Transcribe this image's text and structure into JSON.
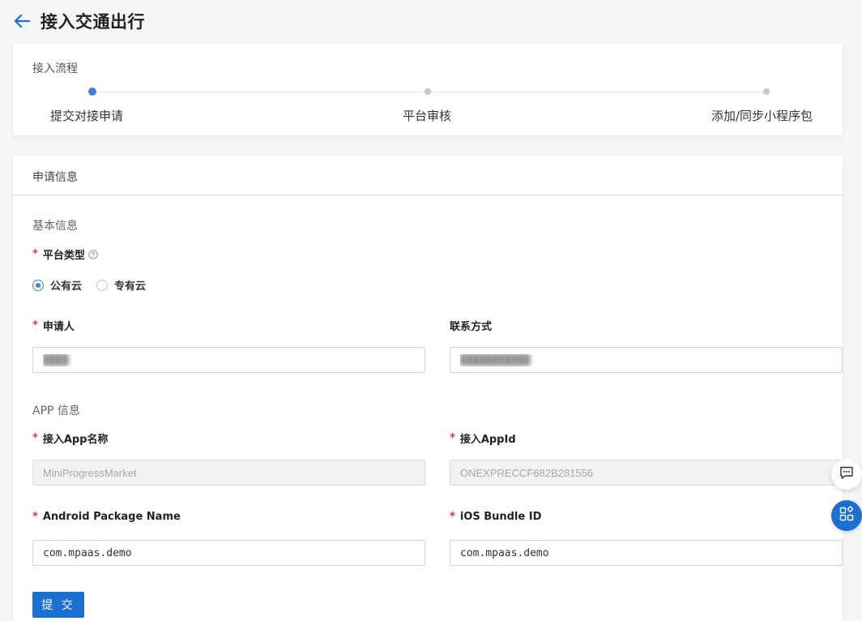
{
  "header": {
    "title": "接入交通出行"
  },
  "flow": {
    "title": "接入流程",
    "steps": [
      {
        "label": "提交对接申请",
        "active": true
      },
      {
        "label": "平台审核",
        "active": false
      },
      {
        "label": "添加/同步小程序包",
        "active": false
      }
    ]
  },
  "form": {
    "title": "申请信息",
    "basic_section": "基本信息",
    "platform_type": {
      "label": "平台类型",
      "options": [
        {
          "label": "公有云",
          "checked": true
        },
        {
          "label": "专有云",
          "checked": false
        }
      ]
    },
    "applicant": {
      "label": "申请人",
      "value": "████"
    },
    "contact": {
      "label": "联系方式",
      "value": "███████████"
    },
    "app_section": "APP 信息",
    "app_name": {
      "label": "接入App名称",
      "value": "MiniProgressMarket"
    },
    "app_id": {
      "label": "接入AppId",
      "value": "ONEXPRECCF682B281556"
    },
    "android_package": {
      "label": "Android Package Name",
      "value": "com.mpaas.demo"
    },
    "ios_bundle": {
      "label": "iOS Bundle ID",
      "value": "com.mpaas.demo"
    },
    "required_mark": "*",
    "submit_label": "提 交"
  },
  "colors": {
    "primary": "#1a6fd1",
    "active_step": "#3e82e0",
    "required": "#e2343b"
  },
  "icons": {
    "back": "arrow-left-icon",
    "help": "question-circle-icon",
    "chat": "chat-bubble-icon",
    "apps": "apps-grid-icon"
  }
}
